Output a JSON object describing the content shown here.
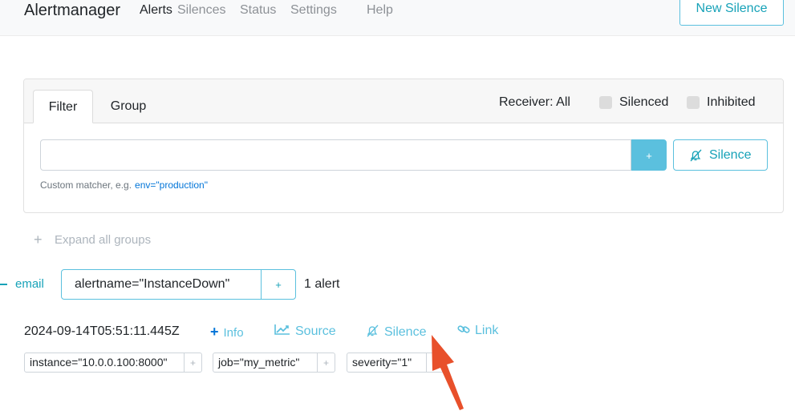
{
  "nav": {
    "brand": "Alertmanager",
    "links": [
      "Alerts",
      "Silences",
      "Status",
      "Settings",
      "Help"
    ],
    "new_silence": "New Silence"
  },
  "filter_card": {
    "tabs": [
      "Filter",
      "Group"
    ],
    "receiver": "Receiver: All",
    "silenced": "Silenced",
    "inhibited": "Inhibited",
    "input_value": "",
    "add_button": "+",
    "silence_button": "Silence",
    "hint_text": "Custom matcher, e.g.",
    "hint_example": "env=\"production\""
  },
  "expand_all": {
    "icon": "+",
    "label": "Expand all groups"
  },
  "group": {
    "receiver": "email",
    "label": "alertname=\"InstanceDown\"",
    "plus": "+",
    "count": "1 alert"
  },
  "alert": {
    "timestamp": "2024-09-14T05:51:11.445Z",
    "actions": {
      "info_icon": "+",
      "info": "Info",
      "source": "Source",
      "silence": "Silence",
      "link": "Link"
    },
    "labels": [
      "instance=\"10.0.0.100:8000\"",
      "job=\"my_metric\"",
      "severity=\"1\""
    ],
    "label_plus": "+"
  },
  "colors": {
    "accent": "#5bc0de",
    "accent_text": "#17a2b8",
    "link_blue": "#0275d8",
    "arrow": "#e8502b"
  }
}
